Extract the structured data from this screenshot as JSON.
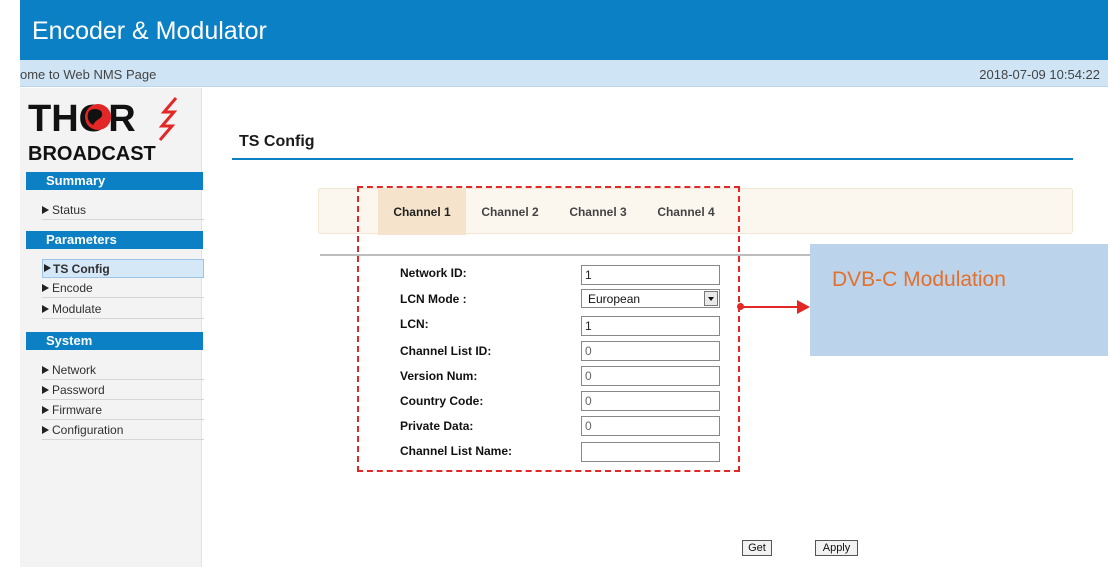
{
  "app": {
    "title": "Encoder & Modulator",
    "welcome": "ome to Web NMS Page",
    "datetime": "2018-07-09 10:54:22"
  },
  "logo": {
    "line1": "THOR",
    "line2": "BROADCAST"
  },
  "sidebar": {
    "sections": [
      {
        "title": "Summary",
        "items": [
          {
            "label": "Status",
            "active": false
          }
        ]
      },
      {
        "title": "Parameters",
        "items": [
          {
            "label": "TS Config",
            "active": true
          },
          {
            "label": "Encode",
            "active": false
          },
          {
            "label": "Modulate",
            "active": false
          }
        ]
      },
      {
        "title": "System",
        "items": [
          {
            "label": "Network",
            "active": false
          },
          {
            "label": "Password",
            "active": false
          },
          {
            "label": "Firmware",
            "active": false
          },
          {
            "label": "Configuration",
            "active": false
          }
        ]
      }
    ]
  },
  "page": {
    "title": "TS Config",
    "tabs": [
      {
        "label": "Channel 1",
        "active": true
      },
      {
        "label": "Channel 2",
        "active": false
      },
      {
        "label": "Channel 3",
        "active": false
      },
      {
        "label": "Channel 4",
        "active": false
      }
    ],
    "fields": {
      "network_id": {
        "label": "Network ID:",
        "value": "1"
      },
      "lcn_mode": {
        "label": "LCN Mode :",
        "value": "European"
      },
      "lcn": {
        "label": "LCN:",
        "value": "1"
      },
      "channel_list_id": {
        "label": "Channel List ID:",
        "value": "0"
      },
      "version_num": {
        "label": "Version Num:",
        "value": "0"
      },
      "country_code": {
        "label": "Country Code:",
        "value": "0"
      },
      "private_data": {
        "label": "Private Data:",
        "value": "0"
      },
      "channel_list_name": {
        "label": "Channel List Name:",
        "value": ""
      }
    },
    "buttons": {
      "get": "Get",
      "apply": "Apply"
    }
  },
  "annotation": {
    "text": "DVB-C Modulation",
    "color": "#e3702a",
    "box_color": "#bcd3ec",
    "dash_color": "#e32626"
  },
  "colors": {
    "brand": "#0b80c4",
    "subheader": "#cfe5f5",
    "tab_active": "#f5e4cb"
  }
}
